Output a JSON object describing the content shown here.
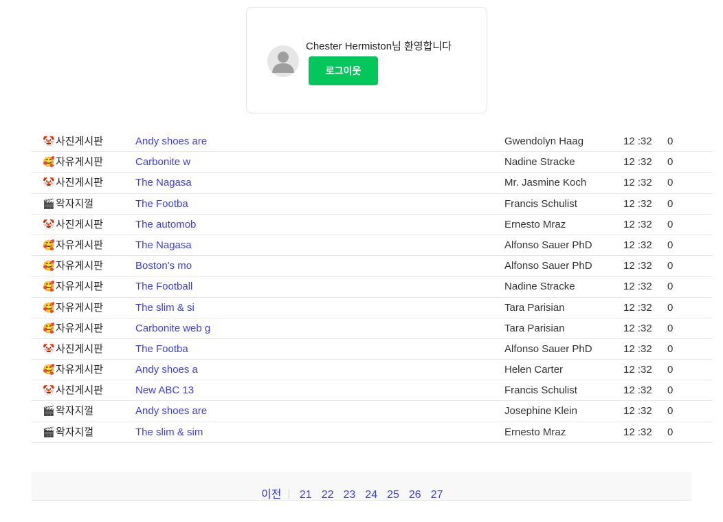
{
  "login": {
    "welcome": "Chester Hermiston님 환영합니다",
    "logout_label": "로그이웃"
  },
  "posts": [
    {
      "category_icon": "clown-face-icon",
      "category": "사진게시판",
      "title": "Andy shoes are",
      "author": "Gwendolyn Haag",
      "time": "12 :32",
      "count": "0"
    },
    {
      "category_icon": "grinning-face-icon",
      "category": "자유게시판",
      "title": "Carbonite w",
      "author": "Nadine Stracke",
      "time": "12 :32",
      "count": "0"
    },
    {
      "category_icon": "clown-face-icon",
      "category": "사진게시판",
      "title": "The Nagasa",
      "author": "Mr. Jasmine Koch",
      "time": "12 :32",
      "count": "0"
    },
    {
      "category_icon": "clapper-board-icon",
      "category": "왁자지껄",
      "title": "The Footba",
      "author": "Francis Schulist",
      "time": "12 :32",
      "count": "0"
    },
    {
      "category_icon": "clown-face-icon",
      "category": "사진게시판",
      "title": "The automob",
      "author": "Ernesto Mraz",
      "time": "12 :32",
      "count": "0"
    },
    {
      "category_icon": "grinning-face-icon",
      "category": "자유게시판",
      "title": "The Nagasa",
      "author": "Alfonso Sauer PhD",
      "time": "12 :32",
      "count": "0"
    },
    {
      "category_icon": "grinning-face-icon",
      "category": "자유게시판",
      "title": "Boston's mo",
      "author": "Alfonso Sauer PhD",
      "time": "12 :32",
      "count": "0"
    },
    {
      "category_icon": "grinning-face-icon",
      "category": "자유게시판",
      "title": "The Football",
      "author": "Nadine Stracke",
      "time": "12 :32",
      "count": "0"
    },
    {
      "category_icon": "grinning-face-icon",
      "category": "자유게시판",
      "title": "The slim & si",
      "author": "Tara Parisian",
      "time": "12 :32",
      "count": "0"
    },
    {
      "category_icon": "grinning-face-icon",
      "category": "자유게시판",
      "title": "Carbonite web g",
      "author": "Tara Parisian",
      "time": "12 :32",
      "count": "0"
    },
    {
      "category_icon": "clown-face-icon",
      "category": "사진게시판",
      "title": "The Footba",
      "author": "Alfonso Sauer PhD",
      "time": "12 :32",
      "count": "0"
    },
    {
      "category_icon": "grinning-face-icon",
      "category": "자유게시판",
      "title": "Andy shoes a",
      "author": "Helen Carter",
      "time": "12 :32",
      "count": "0"
    },
    {
      "category_icon": "clown-face-icon",
      "category": "사진게시판",
      "title": "New ABC 13",
      "author": "Francis Schulist",
      "time": "12 :32",
      "count": "0"
    },
    {
      "category_icon": "clapper-board-icon",
      "category": "왁자지껄",
      "title": "Andy shoes are",
      "author": "Josephine Klein",
      "time": "12 :32",
      "count": "0"
    },
    {
      "category_icon": "clapper-board-icon",
      "category": "왁자지껄",
      "title": "The slim & sim",
      "author": "Ernesto Mraz",
      "time": "12 :32",
      "count": "0"
    }
  ],
  "pagination": {
    "prev_label": "이전",
    "pages": [
      "21",
      "22",
      "23",
      "24",
      "25",
      "26",
      "27"
    ]
  },
  "colors": {
    "accent_green": "#03c75a",
    "link_blue": "#3d3dd6"
  }
}
